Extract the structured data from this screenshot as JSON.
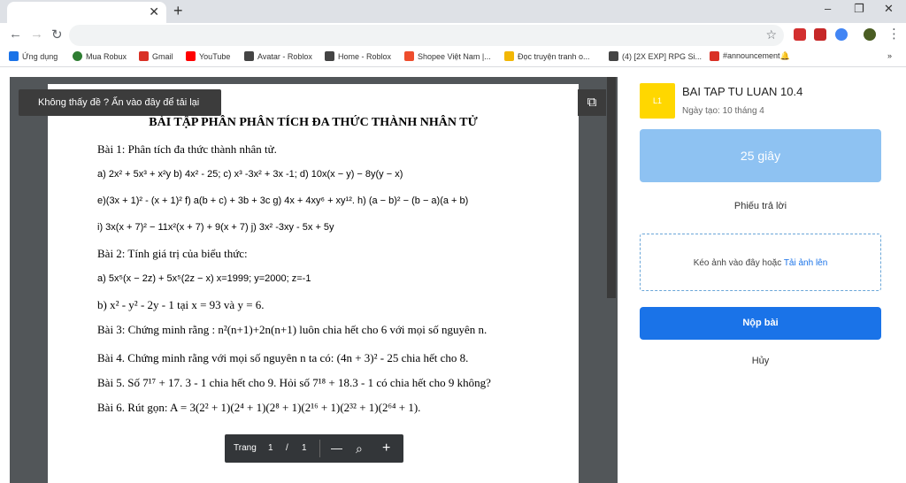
{
  "browser": {
    "tab_title": "",
    "new_tab": "+",
    "window_controls": [
      "–",
      "❐",
      "✕"
    ],
    "bookmarks": [
      {
        "label": "Ứng dụng",
        "icon": "apps-icon",
        "color": "#1a73e8"
      },
      {
        "label": "Mua Robux",
        "icon": "robux-icon",
        "color": "#2e7d32"
      },
      {
        "label": "Gmail",
        "icon": "gmail-icon",
        "color": "#d93025"
      },
      {
        "label": "YouTube",
        "icon": "youtube-icon",
        "color": "#ff0000"
      },
      {
        "label": "Avatar - Roblox",
        "icon": "roblox-icon",
        "color": "#444444"
      },
      {
        "label": "Home - Roblox",
        "icon": "roblox-icon",
        "color": "#444444"
      },
      {
        "label": "Shopee Việt Nam |...",
        "icon": "shopee-icon",
        "color": "#ee4d2d"
      },
      {
        "label": "Đọc truyện tranh o...",
        "icon": "manga-icon",
        "color": "#f2b705"
      },
      {
        "label": "(4) [2X EXP] RPG Si...",
        "icon": "roblox-icon",
        "color": "#444444"
      },
      {
        "label": "#announcement🔔",
        "icon": "discord-icon",
        "color": "#d93025"
      }
    ]
  },
  "viewer": {
    "notice": "Không thấy đề ? Ấn vào đây để tải lại",
    "popout_icon": "open-in-new-icon",
    "pager": {
      "label": "Trang",
      "current": "1",
      "sep": "/",
      "total": "1",
      "zoom_out": "—",
      "zoom_in": "+"
    }
  },
  "document": {
    "title": "BÀI TẬP PHÂN PHÂN TÍCH ĐA THỨC THÀNH NHÂN TỬ",
    "lines": [
      "Bài 1: Phân tích đa thức thành nhân tử.",
      "a) 2x² + 5x³ + x²y     b) 4x² - 25;     c) x³ -3x² + 3x -1;     d) 10x(x − y) − 8y(y − x)",
      "e)(3x + 1)² - (x + 1)²     f) a(b + c) + 3b + 3c     g) 4x + 4xy⁶ + xy¹².     h) (a − b)² − (b − a)(a + b)",
      "i) 3x(x + 7)² − 11x²(x + 7) + 9(x + 7)     j) 3x² -3xy - 5x + 5y",
      "Bài 2: Tính giá trị của biểu thức:",
      "a) 5x⁵(x − 2z) + 5x⁵(2z − x)                                   x=1999; y=2000; z=-1",
      "b) x² - y² - 2y - 1 tại x = 93 và y = 6.",
      "Bài 3: Chứng minh rằng :     n²(n+1)+2n(n+1) luôn chia hết cho 6 với mọi số nguyên n.",
      "Bài 4. Chứng minh rằng với mọi số nguyên n ta có: (4n + 3)² - 25 chia hết cho 8.",
      "Bài 5.  Số 7¹⁷ + 17. 3 - 1 chia hết cho 9. Hỏi số 7¹⁸ + 18.3 - 1 có chia hết cho 9 không?",
      "Bài 6. Rút gọn:     A = 3(2² + 1)(2⁴ + 1)(2⁸ + 1)(2¹⁶ + 1)(2³² + 1)(2⁶⁴ + 1)."
    ]
  },
  "assignment": {
    "avatar": "L1",
    "title": "BAI TAP TU LUAN 10.4",
    "created": "Ngày tạo: 10 tháng 4",
    "timer": "25 giây",
    "answer_sheet": "Phiếu trả lời",
    "drop_text": "Kéo ảnh vào đây hoặc ",
    "upload_link": "Tải ảnh lên",
    "submit": "Nộp bài",
    "cancel": "Hủy"
  }
}
